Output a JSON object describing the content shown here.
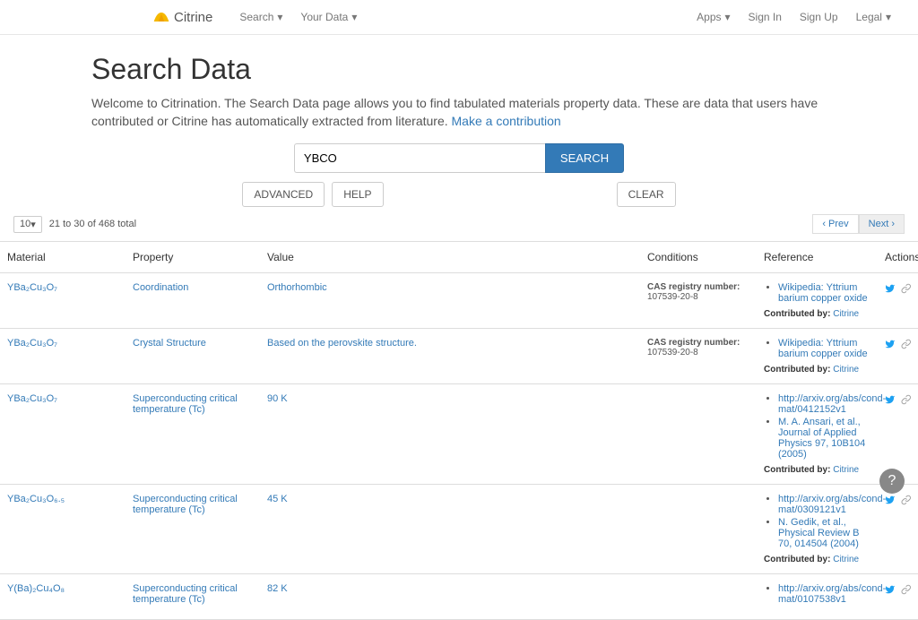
{
  "brand": "Citrine",
  "nav": {
    "search": "Search",
    "yourdata": "Your Data",
    "apps": "Apps",
    "signin": "Sign In",
    "signup": "Sign Up",
    "legal": "Legal"
  },
  "page": {
    "title": "Search Data",
    "intro_a": "Welcome to Citrination. The Search Data page allows you to find tabulated materials property data. These are data that users have contributed or Citrine has automatically extracted from literature. ",
    "make_contrib": "Make a contribution"
  },
  "search": {
    "value": "YBCO",
    "button": "SEARCH",
    "advanced": "ADVANCED",
    "help": "HELP",
    "clear": "CLEAR"
  },
  "results": {
    "page_size": "10",
    "range": "21 to 30 of 468 total",
    "prev": "‹ Prev",
    "next": "Next ›"
  },
  "columns": {
    "material": "Material",
    "property": "Property",
    "value": "Value",
    "conditions": "Conditions",
    "reference": "Reference",
    "actions": "Actions"
  },
  "rows": [
    {
      "material": "YBa₂Cu₃O₇",
      "property": "Coordination",
      "value": "Orthorhombic",
      "cond_label": "CAS registry number:",
      "cond_val": "107539-20-8",
      "refs": [
        "Wikipedia: Yttrium barium copper oxide"
      ],
      "contributor": "Citrine"
    },
    {
      "material": "YBa₂Cu₃O₇",
      "property": "Crystal Structure",
      "value": "Based on the perovskite structure.",
      "cond_label": "CAS registry number:",
      "cond_val": "107539-20-8",
      "refs": [
        "Wikipedia: Yttrium barium copper oxide"
      ],
      "contributor": "Citrine"
    },
    {
      "material": "YBa₂Cu₃O₇",
      "property": "Superconducting critical temperature (Tc)",
      "value": "90 K",
      "cond_label": "",
      "cond_val": "",
      "refs": [
        "http://arxiv.org/abs/cond-mat/0412152v1",
        "M. A. Ansari, et al., Journal of Applied Physics 97, 10B104 (2005)"
      ],
      "contributor": "Citrine"
    },
    {
      "material": "YBa₂Cu₃O₆.₅",
      "property": "Superconducting critical temperature (Tc)",
      "value": "45 K",
      "cond_label": "",
      "cond_val": "",
      "refs": [
        "http://arxiv.org/abs/cond-mat/0309121v1",
        "N. Gedik, et al., Physical Review B 70, 014504 (2004)"
      ],
      "contributor": "Citrine"
    },
    {
      "material": "Y(Ba)₂Cu₄O₈",
      "property": "Superconducting critical temperature (Tc)",
      "value": "82 K",
      "cond_label": "",
      "cond_val": "",
      "refs": [
        "http://arxiv.org/abs/cond-mat/0107538v1"
      ],
      "contributor": ""
    }
  ],
  "labels": {
    "contributed_by": "Contributed by:"
  }
}
